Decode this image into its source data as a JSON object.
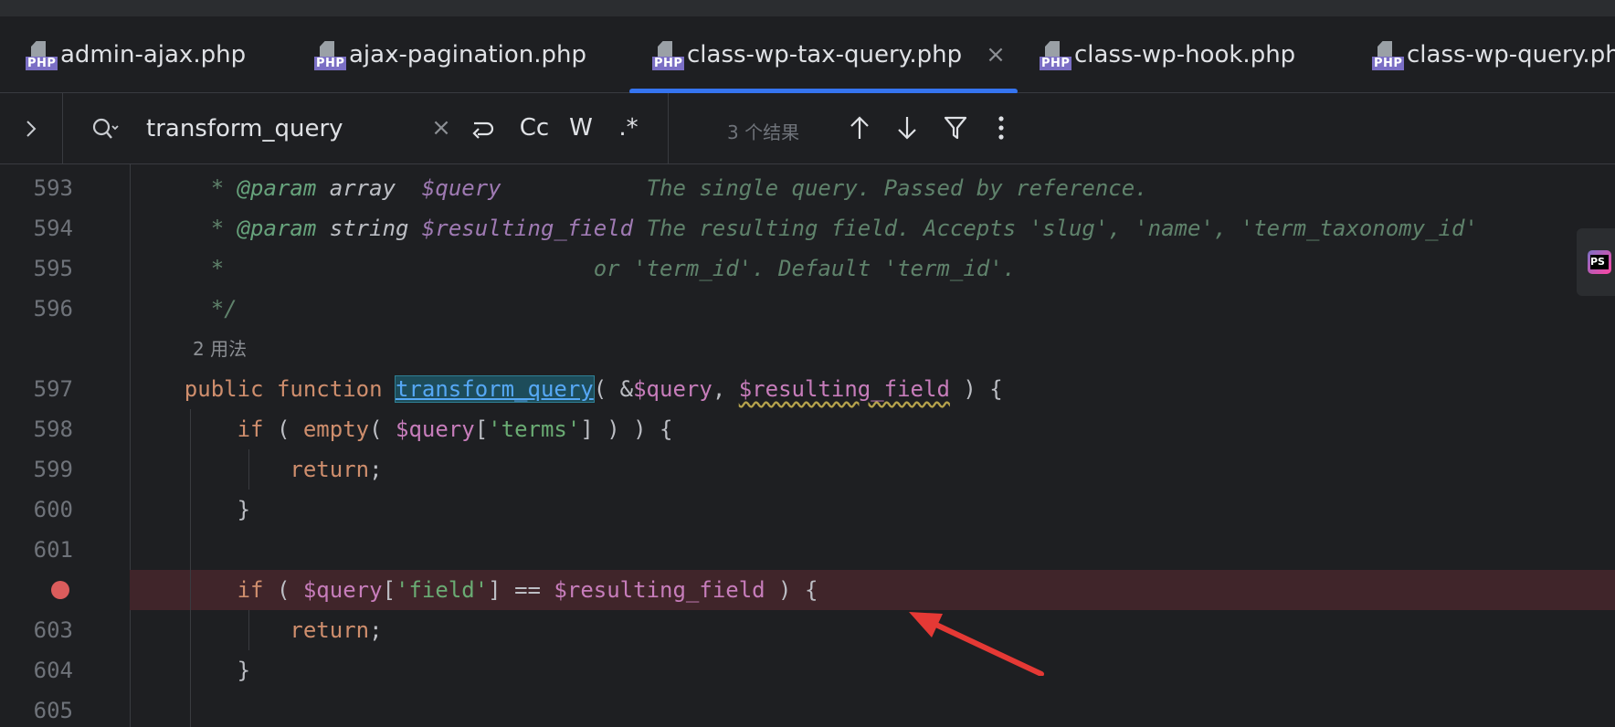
{
  "tabs": [
    {
      "label": "admin-ajax.php",
      "icon": "php-file-icon",
      "active": false
    },
    {
      "label": "ajax-pagination.php",
      "icon": "php-file-icon",
      "active": false
    },
    {
      "label": "class-wp-tax-query.php",
      "icon": "php-file-icon",
      "active": true
    },
    {
      "label": "class-wp-hook.php",
      "icon": "php-file-icon",
      "active": false
    },
    {
      "label": "class-wp-query.ph",
      "icon": "php-file-icon",
      "active": false
    }
  ],
  "icon_label": "PHP",
  "tab_close": "×",
  "search": {
    "query": "transform_query",
    "clear": "×",
    "case_label": "Cc",
    "word_label": "W",
    "regex_label": ".*",
    "results": "3 个结果"
  },
  "editor": {
    "usages": "2 用法",
    "line_numbers": {
      "l593": "593",
      "l594": "594",
      "l595": "595",
      "l596": "596",
      "l597": "597",
      "l598": "598",
      "l599": "599",
      "l600": "600",
      "l601": "601",
      "l603": "603",
      "l604": "604",
      "l605": "605"
    },
    "tokens": {
      "star": "* ",
      "param_tag": "@param",
      "type_array": "array",
      "var_query": "$query",
      "desc_593": "The single query. Passed by reference.",
      "type_string": "string",
      "var_resulting": "$resulting_field",
      "desc_594": "The resulting field. Accepts 'slug', 'name', 'term_taxonomy_id'",
      "star_only": "*",
      "desc_595": "or 'term_id'. Default 'term_id'.",
      "doc_close": "*/",
      "public": "public",
      "function": "function",
      "fn_name": "transform_query",
      "sig_open": "( &",
      "sig_query": "$query",
      "comma": ", ",
      "sig_resulting": "$resulting_field",
      "sig_close": " ) {",
      "if": "if",
      "paren_open": " ( ",
      "empty": "empty",
      "paren_open_nospace": "( ",
      "query_var": "$query",
      "bracket_open": "[",
      "terms": "'terms'",
      "bracket_close_598": "] ) ) {",
      "return": "return",
      "semicolon": ";",
      "brace_close": "}",
      "field": "'field'",
      "eq": "] == ",
      "resulting": "$resulting_field",
      "tail_602": " ) {"
    }
  }
}
